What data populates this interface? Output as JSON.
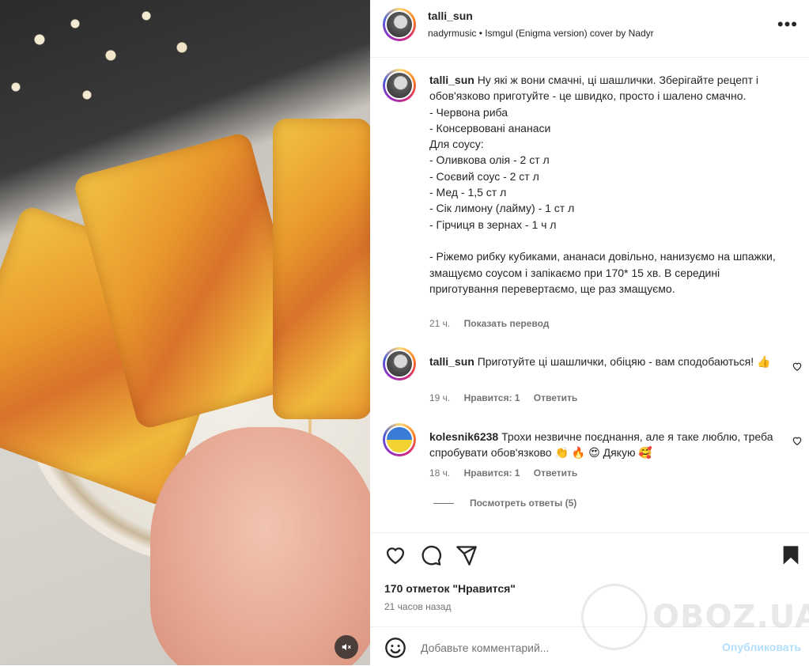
{
  "post": {
    "author": "talli_sun",
    "audio": "nadyrmusic • Ismgul (Enigma version) cover by Nadyr",
    "caption_author": "talli_sun",
    "caption_text": "Ну які ж вони смачні, ці шашлички. Зберігайте рецепт і обов'язково приготуйте - це швидко, просто і шалено смачно.\n- Червона риба\n- Консервовані ананаси\nДля соусу:\n- Оливкова олія - 2 ст л\n- Соєвий соус - 2 ст л\n- Мед - 1,5 ст л\n- Сік лимону (лайму) - 1 ст л\n- Гірчиця в зернах - 1 ч л\n\n- Ріжемо рибку кубиками, ананаси довільно, нанизуємо на шпажки, змащуємо соусом і запікаємо при 170* 15 хв. В середині приготування перевертаємо, ще раз змащуємо.",
    "caption_time": "21 ч.",
    "translate_label": "Показать перевод"
  },
  "comments": [
    {
      "author": "talli_sun",
      "text": "Приготуйте ці шашлички, обіцяю - вам сподобаються! 👍",
      "time": "19 ч.",
      "likes_label": "Нравится: 1",
      "reply_label": "Ответить"
    },
    {
      "author": "kolesnik6238",
      "text": "Трохи незвичне поєднання, але я таке люблю, треба спробувати обов'язково 👏 🔥 😍 Дякую 🥰",
      "time": "18 ч.",
      "likes_label": "Нравится: 1",
      "reply_label": "Ответить"
    }
  ],
  "view_replies": "Посмотреть ответы (5)",
  "footer": {
    "likes": "170 отметок \"Нравится\"",
    "time": "21 часов назад",
    "comment_placeholder": "Добавьте комментарий...",
    "publish_label": "Опубликовать"
  },
  "watermark": "OBOZ.UA",
  "colors": {
    "text": "#262626",
    "secondary": "#737373",
    "publish_disabled": "#b2dffc",
    "divider": "#efefef"
  },
  "icons": [
    "more-icon",
    "heart-icon",
    "comment-icon",
    "share-icon",
    "bookmark-icon",
    "emoji-icon",
    "mute-icon"
  ]
}
